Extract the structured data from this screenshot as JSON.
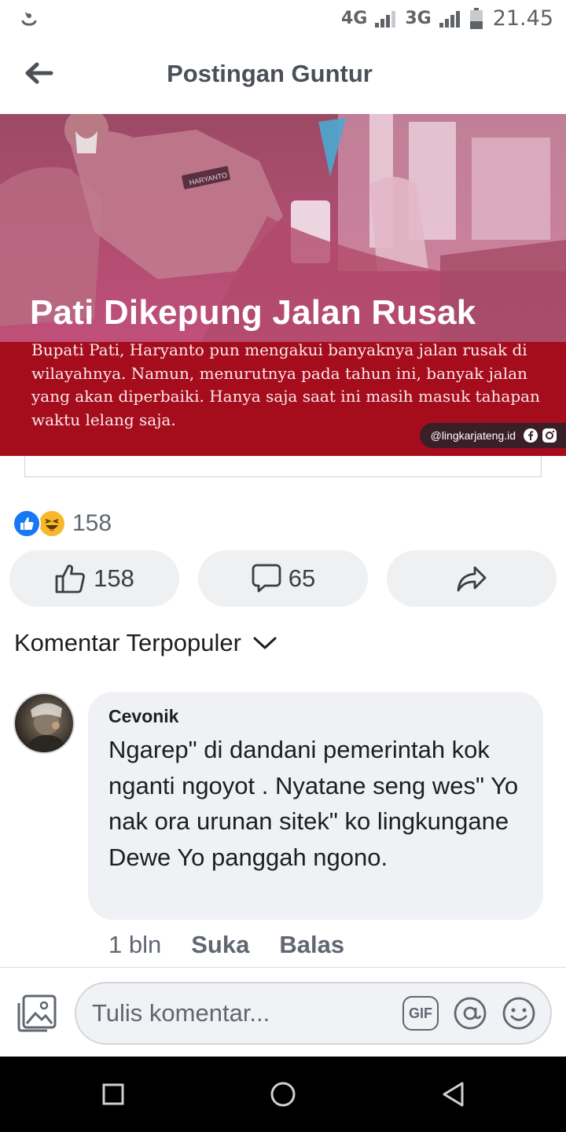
{
  "status_bar": {
    "network_1": "4G",
    "network_2": "3G",
    "time": "21.45",
    "icons": [
      "notification-icon",
      "signal-icon",
      "battery-icon"
    ]
  },
  "header": {
    "title": "Postingan Guntur",
    "back_icon": "arrow-left-icon"
  },
  "post_image": {
    "headline": "Pati Dikepung Jalan Rusak",
    "caption": "Bupati Pati, Haryanto pun mengakui banyaknya jalan rusak di wilayahnya. Namun, menurutnya pada tahun ini, banyak jalan yang akan diperbaiki. Hanya saja saat ini masih masuk tahapan waktu lelang saja.",
    "watermark": "@lingkarjateng.id",
    "name_tag": "HARYANTO"
  },
  "reactions": {
    "icons": [
      "like-reaction-icon",
      "haha-reaction-icon"
    ],
    "count": "158"
  },
  "actions": {
    "like_count": "158",
    "comment_count": "65",
    "share_icon": "share-icon"
  },
  "comments_sort": {
    "label": "Komentar Terpopuler"
  },
  "comment": {
    "author": "Cevonik",
    "text": "Ngarep\" di dandani pemerintah kok nganti ngoyot . Nyatane seng wes\" Yo nak ora urunan sitek\" ko lingkungane Dewe Yo panggah ngono.",
    "time": "1 bln",
    "like_label": "Suka",
    "reply_label": "Balas"
  },
  "composer": {
    "placeholder": "Tulis komentar...",
    "gif_label": "GIF"
  },
  "colors": {
    "accent_blue": "#1877f2",
    "banner_red": "#a50d1d",
    "text_gray": "#606770"
  }
}
